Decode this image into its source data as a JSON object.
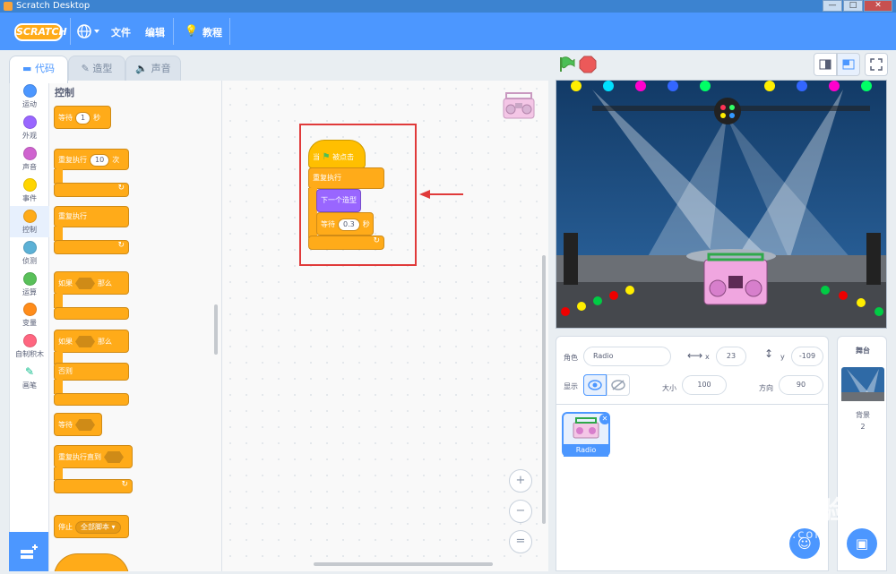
{
  "window": {
    "title": "Scratch Desktop",
    "minimize": "—",
    "maximize": "□",
    "close": "✕"
  },
  "menu": {
    "logo": "SCRATCH",
    "language_icon": "globe-icon",
    "file": "文件",
    "edit": "编辑",
    "tutorials": "教程"
  },
  "tabs": [
    {
      "label": "代码",
      "icon": "code-icon"
    },
    {
      "label": "造型",
      "icon": "brush-icon"
    },
    {
      "label": "声音",
      "icon": "speaker-icon"
    }
  ],
  "categories": [
    {
      "label": "运动",
      "color": "#4c97ff"
    },
    {
      "label": "外观",
      "color": "#9966ff"
    },
    {
      "label": "声音",
      "color": "#cf63cf"
    },
    {
      "label": "事件",
      "color": "#ffd500"
    },
    {
      "label": "控制",
      "color": "#ffab19"
    },
    {
      "label": "侦测",
      "color": "#5cb1d6"
    },
    {
      "label": "运算",
      "color": "#59c059"
    },
    {
      "label": "变量",
      "color": "#ff8c1a"
    },
    {
      "label": "自制积木",
      "color": "#ff6680"
    },
    {
      "label": "画笔",
      "color": "#0fbd8c"
    }
  ],
  "palette": {
    "heading": "控制",
    "wait": {
      "label": "等待",
      "value": "1",
      "unit": "秒"
    },
    "repeat": {
      "label": "重复执行",
      "value": "10",
      "unit": "次"
    },
    "forever": {
      "label": "重复执行"
    },
    "if_then": {
      "label": "如果",
      "then": "那么"
    },
    "if_else": {
      "label": "如果",
      "then": "那么",
      "else": "否则"
    },
    "wait_until": {
      "label": "等待"
    },
    "repeat_until": {
      "label": "重复执行直到"
    },
    "stop": {
      "label": "停止",
      "option": "全部脚本 ▾"
    }
  },
  "script": {
    "hat": {
      "prefix": "当",
      "suffix": "被点击"
    },
    "forever": "重复执行",
    "next_costume": "下一个造型",
    "wait": {
      "label": "等待",
      "value": "0.3",
      "unit": "秒"
    }
  },
  "zoom": {
    "in": "+",
    "out": "−",
    "reset": "="
  },
  "sprite": {
    "label_sprite": "角色",
    "name": "Radio",
    "label_x": "x",
    "x": "23",
    "label_y": "y",
    "y": "-109",
    "label_show": "显示",
    "label_size": "大小",
    "size": "100",
    "label_direction": "方向",
    "direction": "90",
    "thumb_name": "Radio"
  },
  "stage_panel": {
    "title": "舞台",
    "backdrops_label": "背景",
    "backdrops_count": "2"
  },
  "watermark": {
    "brand": "Bai du 经验",
    "url": "jingyan.baidu.com"
  },
  "colors": {
    "accent": "#4c97ff",
    "control": "#ffab19",
    "looks": "#9966ff",
    "highlight": "#e03a3a"
  }
}
